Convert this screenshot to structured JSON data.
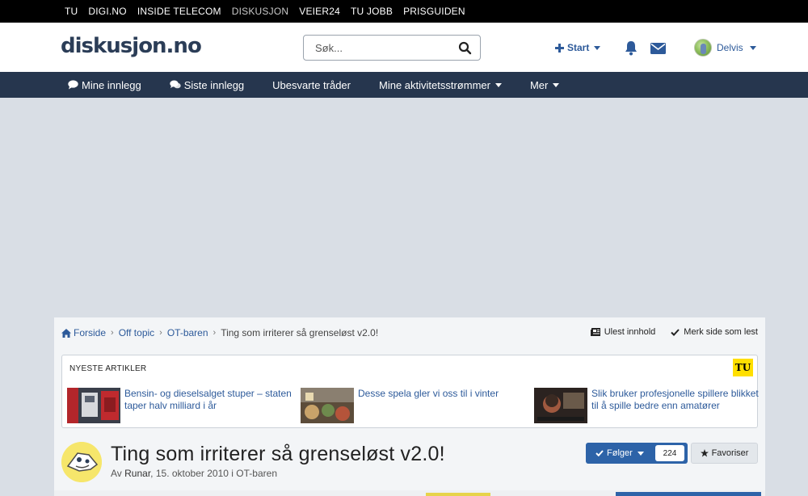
{
  "network_bar": {
    "links": [
      {
        "label": "TU"
      },
      {
        "label": "DIGI.NO"
      },
      {
        "label": "INSIDE TELECOM"
      },
      {
        "label": "DISKUSJON"
      },
      {
        "label": "VEIER24"
      },
      {
        "label": "TU JOBB"
      },
      {
        "label": "PRISGUIDEN"
      }
    ]
  },
  "header": {
    "logo": "diskusjon.no",
    "search_placeholder": "Søk...",
    "start_label": "Start",
    "user_name": "Delvis"
  },
  "navbar": {
    "items": [
      {
        "label": "Mine innlegg",
        "icon": "comment-icon"
      },
      {
        "label": "Siste innlegg",
        "icon": "comments-icon"
      },
      {
        "label": "Ubesvarte tråder"
      },
      {
        "label": "Mine aktivitetsstrømmer",
        "icon": "caret-down-icon"
      },
      {
        "label": "Mer",
        "icon": "caret-down-icon"
      }
    ]
  },
  "breadcrumb": {
    "items": [
      "Forside",
      "Off topic",
      "OT-baren",
      "Ting som irriterer så grenseløst v2.0!"
    ]
  },
  "actions": {
    "unread": "Ulest innhold",
    "mark_read": "Merk side som lest"
  },
  "articles": {
    "title": "NYESTE ARTIKLER",
    "badge": "TU",
    "items": [
      {
        "title": "Bensin- og dieselsalget stuper – staten taper halv milliard i år"
      },
      {
        "title": "Desse spela gler vi oss til i vinter"
      },
      {
        "title": "Slik bruker profesjonelle spillere blikket til å spille bedre enn amatører"
      }
    ]
  },
  "topic": {
    "title": "Ting som irriterer så grenseløst v2.0!",
    "meta_prefix": "Av",
    "author": "Runar",
    "date": "15. oktober 2010",
    "meta_in": "i",
    "forum": "OT-baren",
    "follow_label": "Følger",
    "follow_count": "224",
    "favorite_label": "Favoriser"
  },
  "colors": {
    "brand_navy": "#26364e",
    "link_blue": "#2d5a9a",
    "follow_blue": "#2d63a8",
    "page_bg": "#d9dee5"
  }
}
